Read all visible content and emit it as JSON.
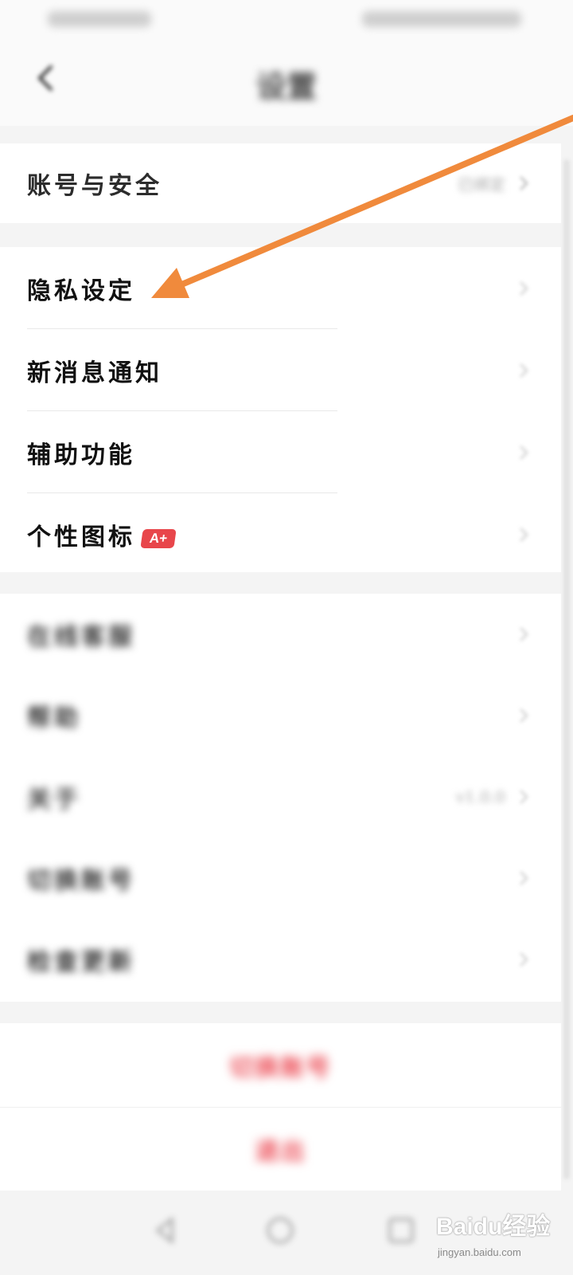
{
  "header": {
    "title": "设置"
  },
  "groups": {
    "account": {
      "label": "账号与安全",
      "value": "已绑定"
    },
    "main": [
      {
        "label": "隐私设定"
      },
      {
        "label": "新消息通知"
      },
      {
        "label": "辅助功能"
      },
      {
        "label": "个性图标",
        "badge": "A+"
      }
    ],
    "info": [
      {
        "label": "在线客服"
      },
      {
        "label": "帮助"
      },
      {
        "label": "关于",
        "value": "v1.0.0"
      },
      {
        "label": "切换账号"
      },
      {
        "label": "检查更新"
      }
    ]
  },
  "actions": {
    "switch_account": "切换账号",
    "logout": "退出"
  },
  "colors": {
    "accent": "#ec4b55",
    "arrow": "#f08a3c",
    "badge": "#e8464b"
  },
  "watermark": {
    "logo": "Baidu经验",
    "url": "jingyan.baidu.com"
  }
}
